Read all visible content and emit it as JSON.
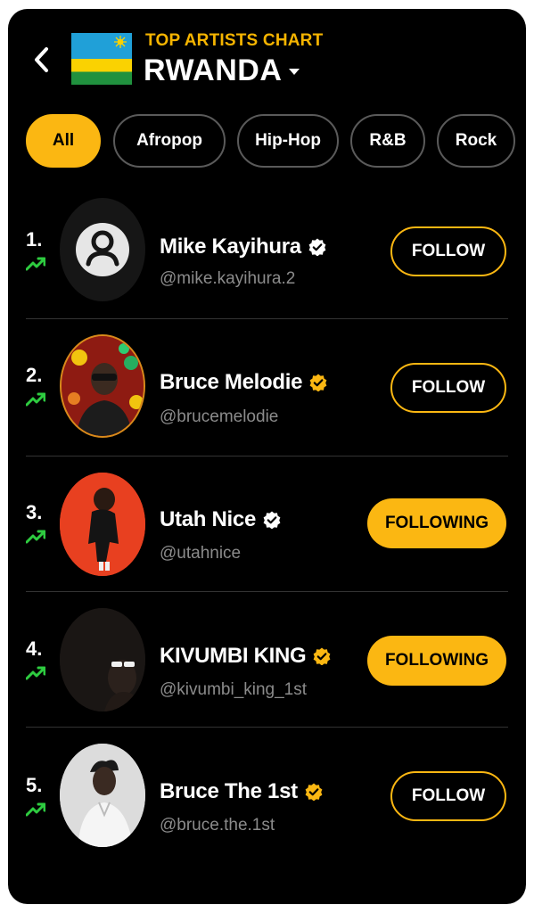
{
  "header": {
    "kicker": "TOP ARTISTS CHART",
    "country": "RWANDA",
    "flag_colors": [
      "#20a0d8",
      "#fad201",
      "#20913e"
    ]
  },
  "genres": [
    {
      "label": "All",
      "active": true
    },
    {
      "label": "Afropop",
      "active": false
    },
    {
      "label": "Hip-Hop",
      "active": false
    },
    {
      "label": "R&B",
      "active": false
    },
    {
      "label": "Rock",
      "active": false
    }
  ],
  "artists": [
    {
      "rank": "1.",
      "name": "Mike Kayihura",
      "handle": "@mike.kayihura.2",
      "verified": "white",
      "button": "FOLLOW",
      "following": false,
      "trend": "up"
    },
    {
      "rank": "2.",
      "name": "Bruce Melodie",
      "handle": "@brucemelodie",
      "verified": "gold",
      "button": "FOLLOW",
      "following": false,
      "trend": "up"
    },
    {
      "rank": "3.",
      "name": "Utah Nice",
      "handle": "@utahnice",
      "verified": "white",
      "button": "FOLLOWING",
      "following": true,
      "trend": "up"
    },
    {
      "rank": "4.",
      "name": "KIVUMBI KING",
      "handle": "@kivumbi_king_1st",
      "verified": "gold",
      "button": "FOLLOWING",
      "following": true,
      "trend": "up"
    },
    {
      "rank": "5.",
      "name": "Bruce The 1st",
      "handle": "@bruce.the.1st",
      "verified": "gold",
      "button": "FOLLOW",
      "following": false,
      "trend": "up"
    }
  ],
  "colors": {
    "accent": "#fbb712",
    "trend_up": "#2ecc40"
  }
}
